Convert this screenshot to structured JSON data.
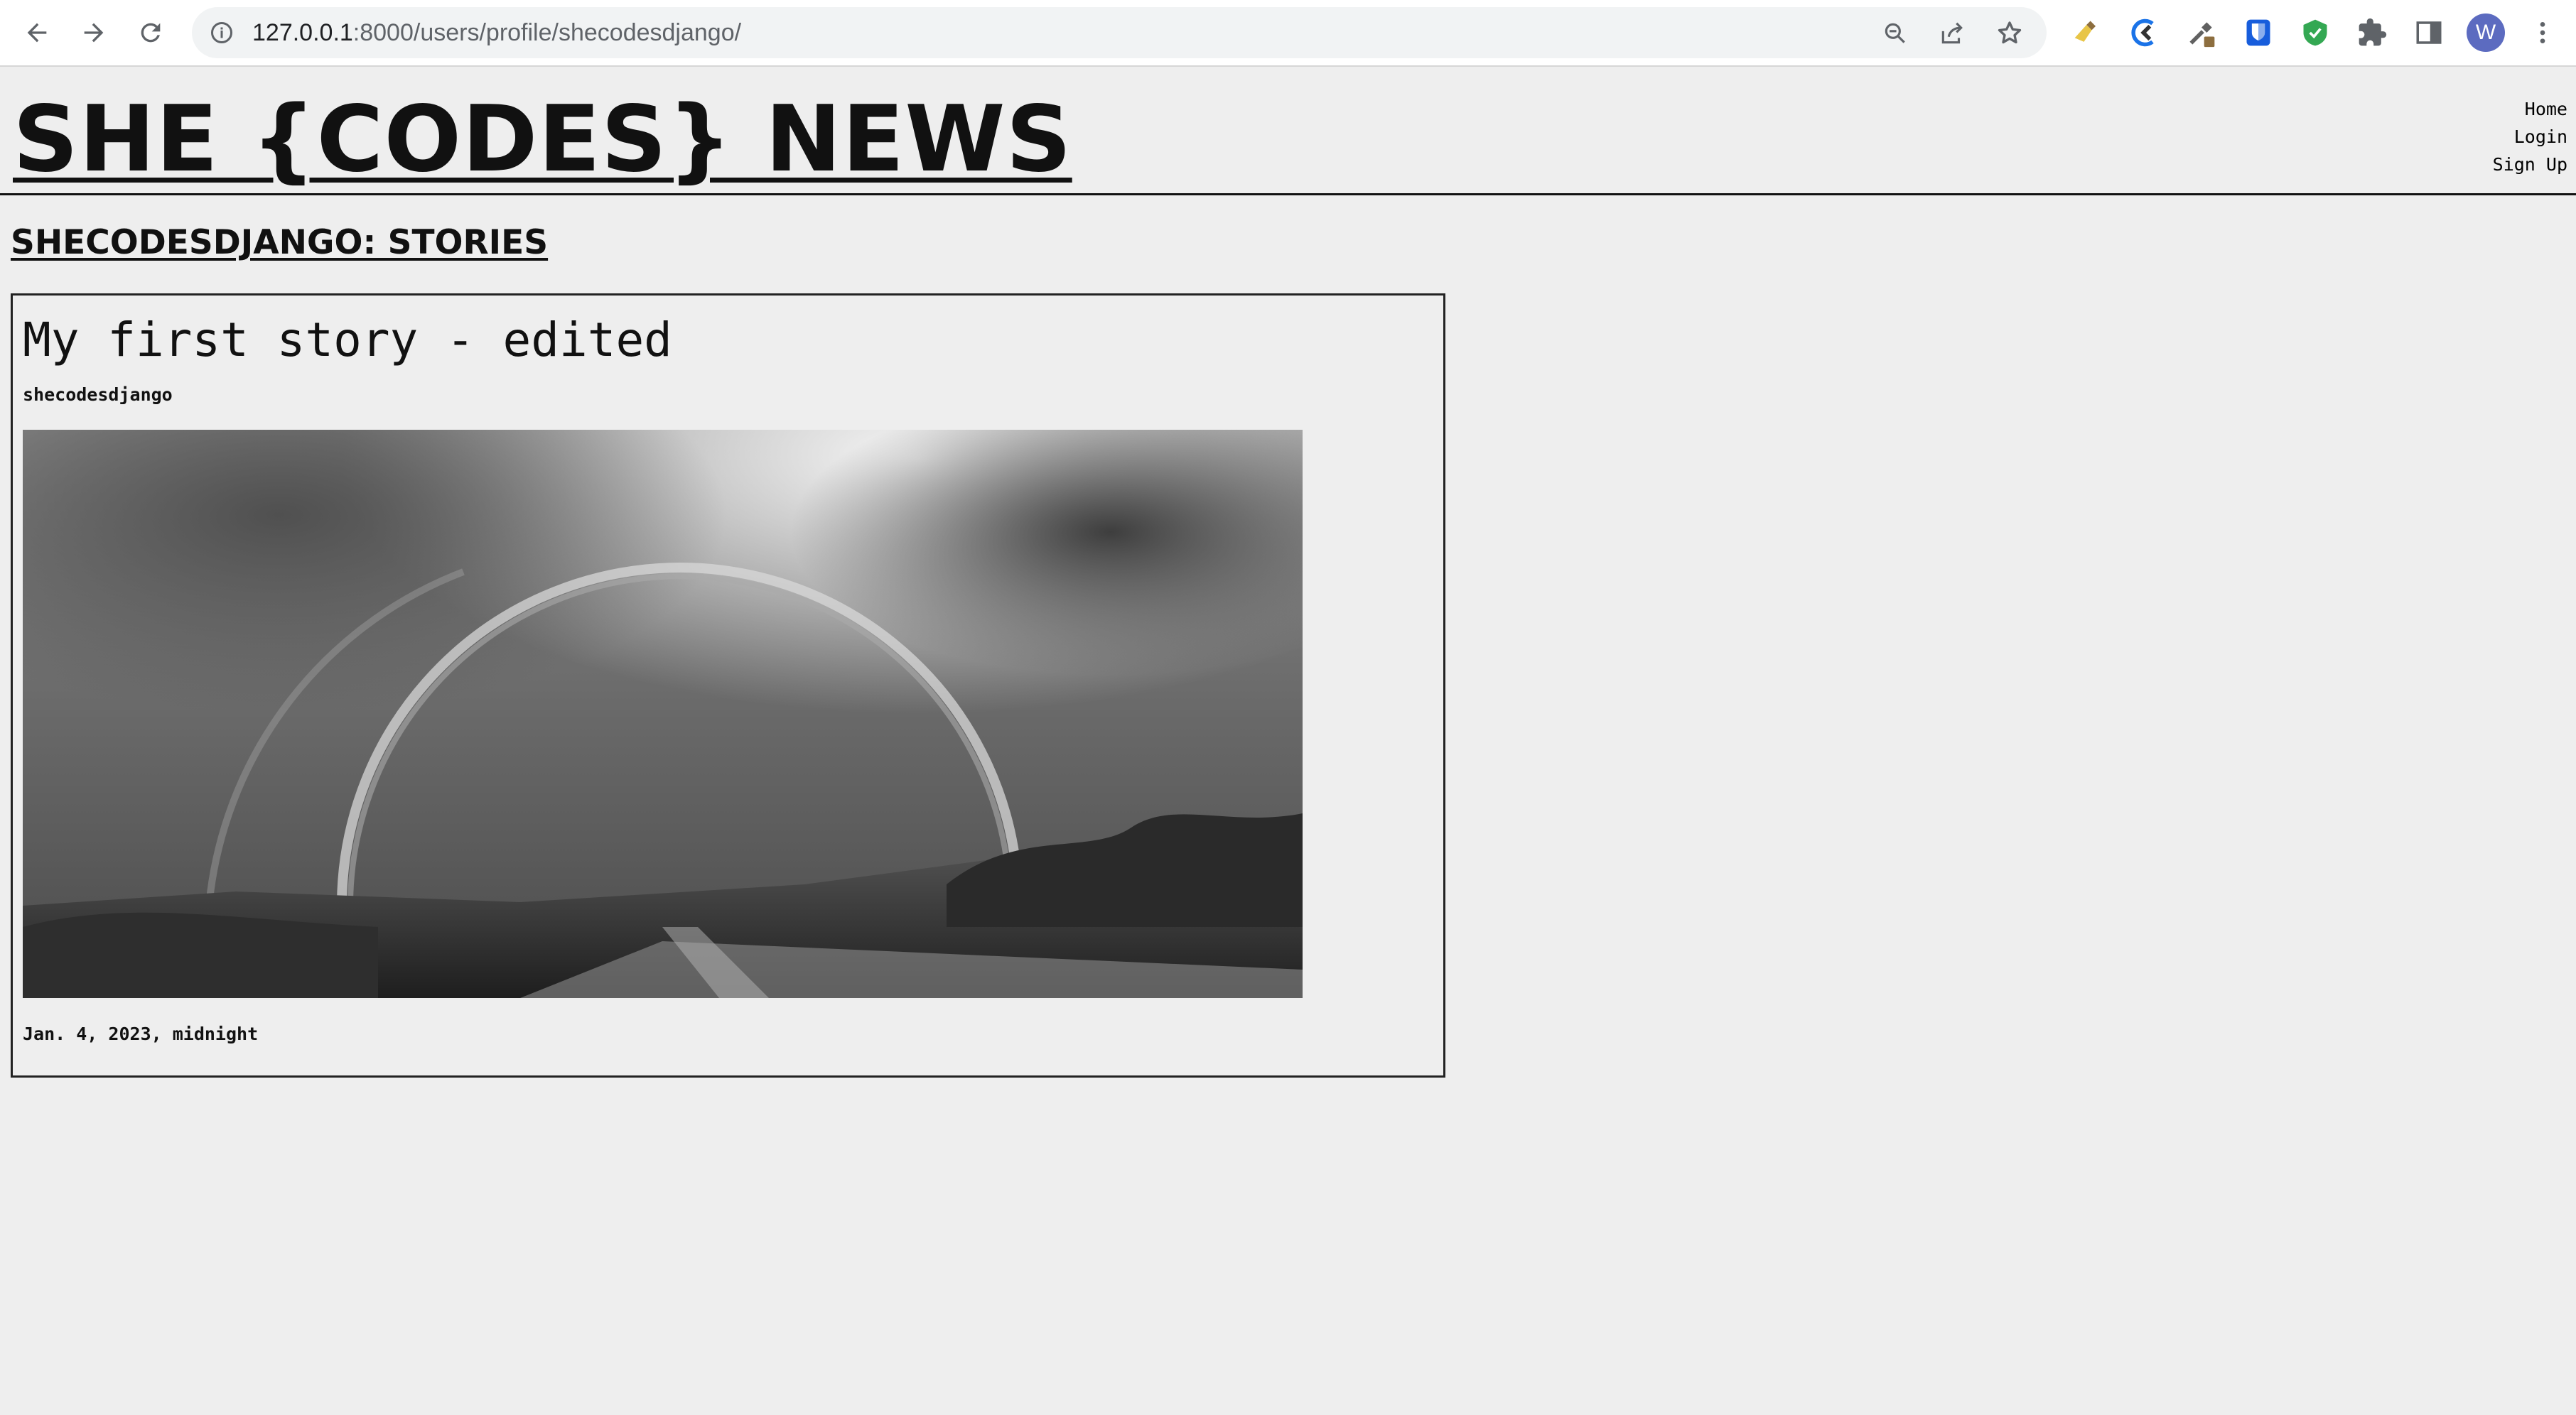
{
  "browser": {
    "url_host": "127.0.0.1",
    "url_path": ":8000/users/profile/shecodesdjango/",
    "profile_initial": "W"
  },
  "site": {
    "title": "SHE {CODES} NEWS",
    "nav": [
      "Home",
      "Login",
      "Sign Up"
    ]
  },
  "profile": {
    "heading": "SHECODESDJANGO: STORIES"
  },
  "stories": [
    {
      "title": "My first story - edited",
      "author": "shecodesdjango",
      "image_alt": "Black and white photo of a rainbow over a field",
      "date": "Jan. 4, 2023, midnight"
    }
  ],
  "colors": {
    "page_bg": "#eeeeee",
    "text": "#111111",
    "chrome_bg": "#ffffff",
    "omnibox_bg": "#f1f3f4",
    "avatar": "#5c6bc0"
  }
}
